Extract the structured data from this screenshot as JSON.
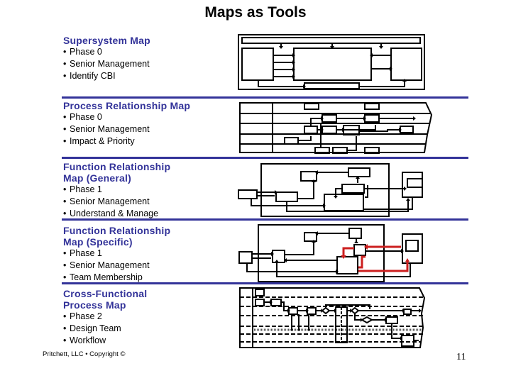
{
  "slide": {
    "title": "Maps as Tools",
    "footer": "Pritchett, LLC • Copyright ©",
    "page_number": "11"
  },
  "sections": [
    {
      "title_lines": [
        "Supersystem Map"
      ],
      "bullets": [
        "Phase 0",
        "Senior Management",
        "Identify CBI"
      ],
      "diagram": "supersystem-map-diagram"
    },
    {
      "title_lines": [
        "Process Relationship Map"
      ],
      "bullets": [
        "Phase 0",
        "Senior Management",
        "Impact & Priority"
      ],
      "diagram": "process-relationship-map-diagram"
    },
    {
      "title_lines": [
        "Function Relationship",
        "Map (General)"
      ],
      "bullets": [
        "Phase 1",
        "Senior Management",
        "Understand & Manage"
      ],
      "diagram": "function-relationship-general-diagram"
    },
    {
      "title_lines": [
        "Function Relationship",
        "Map (Specific)"
      ],
      "bullets": [
        "Phase 1",
        "Senior Management",
        "Team Membership"
      ],
      "diagram": "function-relationship-specific-diagram"
    },
    {
      "title_lines": [
        "Cross-Functional",
        "Process Map"
      ],
      "bullets": [
        "Phase 2",
        "Design Team",
        "Workflow"
      ],
      "diagram": "cross-functional-process-map-diagram"
    }
  ],
  "colors": {
    "section_title": "#333399",
    "separator": "#333399",
    "highlight_path": "#cc1f1f"
  },
  "bullet_glyph": "•"
}
